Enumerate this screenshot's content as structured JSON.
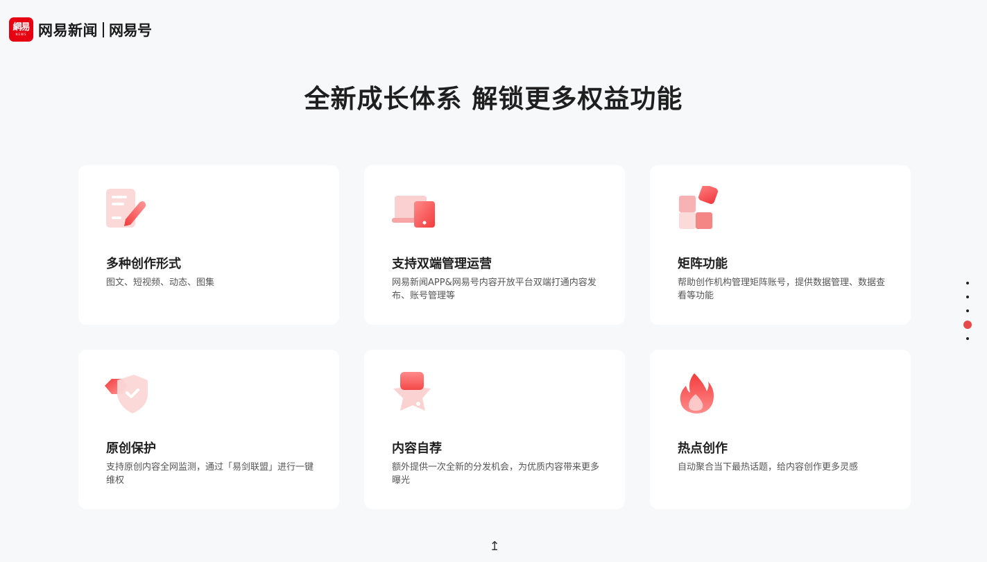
{
  "header": {
    "logo_mark": "網易",
    "logo_mark_sub": "NEWS",
    "brand_name": "网易新闻",
    "brand_sub": "网易号"
  },
  "title": "全新成长体系 解锁更多权益功能",
  "features": [
    {
      "icon": "document-edit-icon",
      "title": "多种创作形式",
      "desc": "图文、短视频、动态、图集"
    },
    {
      "icon": "dual-device-icon",
      "title": "支持双端管理运营",
      "desc": "网易新闻APP&网易号内容开放平台双端打通内容发布、账号管理等"
    },
    {
      "icon": "matrix-blocks-icon",
      "title": "矩阵功能",
      "desc": "帮助创作机构管理矩阵账号，提供数据管理、数据查看等功能"
    },
    {
      "icon": "shield-check-icon",
      "title": "原创保护",
      "desc": "支持原创内容全网监测，通过「易剑联盟」进行一键维权"
    },
    {
      "icon": "star-recommend-icon",
      "title": "内容自荐",
      "desc": "额外提供一次全新的分发机会，为优质内容带来更多曝光"
    },
    {
      "icon": "flame-icon",
      "title": "热点创作",
      "desc": "自动聚合当下最热话题，给内容创作更多灵感"
    }
  ],
  "pager": {
    "count": 5,
    "active_index": 3
  },
  "scroll_up_glyph": "↥",
  "colors": {
    "accent": "#e84a4a",
    "brand": "#e60012",
    "background": "#f7f8fa"
  }
}
